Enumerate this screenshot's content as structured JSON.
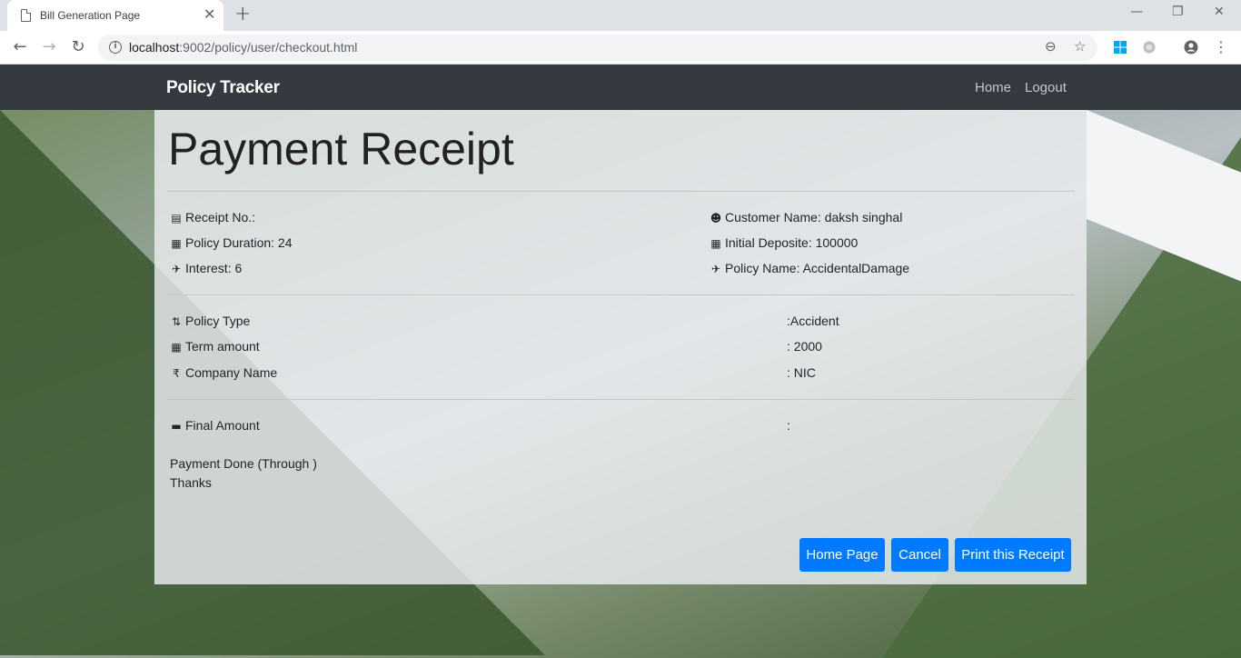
{
  "browser": {
    "tab_title": "Bill Generation Page",
    "url_host": "localhost",
    "url_path": ":9002/policy/user/checkout.html"
  },
  "navbar": {
    "brand": "Policy Tracker",
    "links": [
      "Home",
      "Logout"
    ]
  },
  "receipt": {
    "heading": "Payment Receipt",
    "left_info": [
      {
        "icon": "receipt-icon",
        "text": "Receipt No.:"
      },
      {
        "icon": "calendar-icon",
        "text": "Policy Duration: 24"
      },
      {
        "icon": "plane-departure-icon",
        "text": "Interest: 6"
      }
    ],
    "right_info": [
      {
        "icon": "users-icon",
        "text": "Customer Name: daksh singhal"
      },
      {
        "icon": "calendar-icon",
        "text": "Initial Deposite: 100000"
      },
      {
        "icon": "plane-arrival-icon",
        "text": "Policy Name: AccidentalDamage"
      }
    ],
    "details": [
      {
        "icon": "sort-icon",
        "label": "Policy Type",
        "value": ":Accident"
      },
      {
        "icon": "calendar-icon",
        "label": "Term amount",
        "value": ": 2000"
      },
      {
        "icon": "rupee-icon",
        "label": "Company Name",
        "value": ": NIC"
      }
    ],
    "final": {
      "icon": "money-bill-icon",
      "label": "Final Amount",
      "value": ":"
    },
    "payment_note": "Payment Done (Through )",
    "thanks": "Thanks"
  },
  "buttons": {
    "home": "Home Page",
    "cancel": "Cancel",
    "print": "Print this Receipt"
  },
  "colors": {
    "navbar": "#343a40",
    "primary_button": "#007bff"
  }
}
